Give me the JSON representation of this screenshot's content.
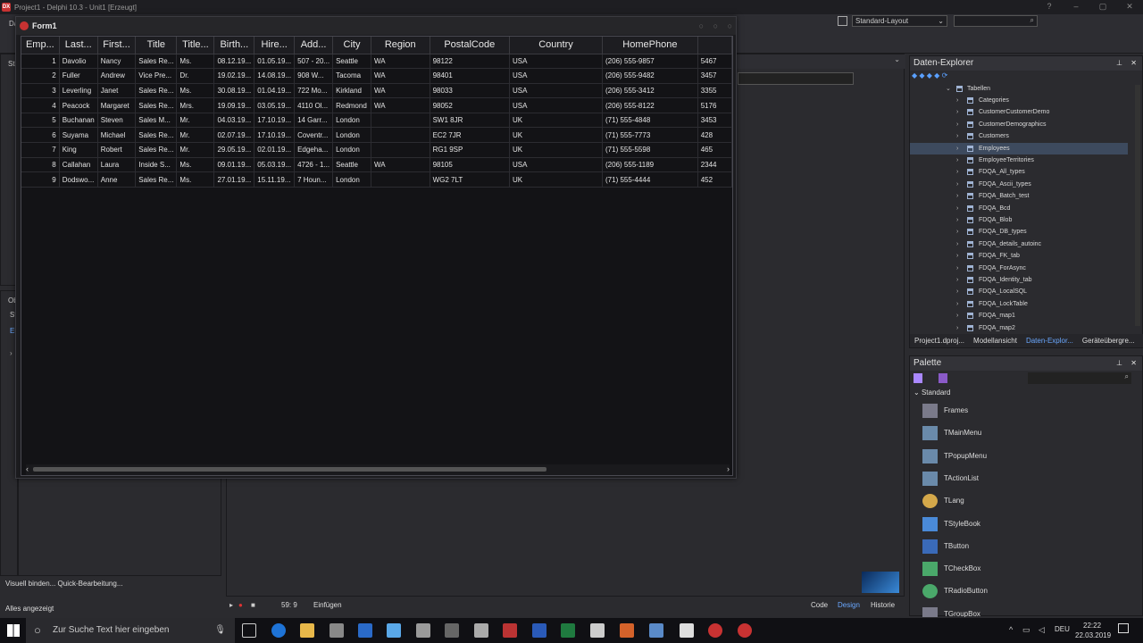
{
  "ide": {
    "title": "Project1 - Delphi 10.3 - Unit1 [Erzeugt]",
    "logo_text": "DX",
    "layout_select": "Standard-Layout",
    "toolbar_menu": "Da",
    "left_labels": [
      "Str",
      "Ob",
      "St",
      "Ei"
    ]
  },
  "form": {
    "title": "Form1",
    "columns": [
      "Emp...",
      "Last...",
      "First...",
      "Title",
      "Title...",
      "Birth...",
      "Hire...",
      "Add...",
      "City",
      "Region",
      "PostalCode",
      "Country",
      "HomePhone"
    ],
    "rows": [
      [
        "1",
        "Davolio",
        "Nancy",
        "Sales Re...",
        "Ms.",
        "08.12.19...",
        "01.05.19...",
        "507 - 20...",
        "Seattle",
        "WA",
        "98122",
        "USA",
        "(206) 555-9857",
        "5467"
      ],
      [
        "2",
        "Fuller",
        "Andrew",
        "Vice Pre...",
        "Dr.",
        "19.02.19...",
        "14.08.19...",
        "908 W...",
        "Tacoma",
        "WA",
        "98401",
        "USA",
        "(206) 555-9482",
        "3457"
      ],
      [
        "3",
        "Leverling",
        "Janet",
        "Sales Re...",
        "Ms.",
        "30.08.19...",
        "01.04.19...",
        "722 Mo...",
        "Kirkland",
        "WA",
        "98033",
        "USA",
        "(206) 555-3412",
        "3355"
      ],
      [
        "4",
        "Peacock",
        "Margaret",
        "Sales Re...",
        "Mrs.",
        "19.09.19...",
        "03.05.19...",
        "4110 Ol...",
        "Redmond",
        "WA",
        "98052",
        "USA",
        "(206) 555-8122",
        "5176"
      ],
      [
        "5",
        "Buchanan",
        "Steven",
        "Sales M...",
        "Mr.",
        "04.03.19...",
        "17.10.19...",
        "14 Garr...",
        "London",
        "",
        "SW1 8JR",
        "UK",
        "(71) 555-4848",
        "3453"
      ],
      [
        "6",
        "Suyama",
        "Michael",
        "Sales Re...",
        "Mr.",
        "02.07.19...",
        "17.10.19...",
        "Coventr...",
        "London",
        "",
        "EC2 7JR",
        "UK",
        "(71) 555-7773",
        "428"
      ],
      [
        "7",
        "King",
        "Robert",
        "Sales Re...",
        "Mr.",
        "29.05.19...",
        "02.01.19...",
        "Edgeha...",
        "London",
        "",
        "RG1 9SP",
        "UK",
        "(71) 555-5598",
        "465"
      ],
      [
        "8",
        "Callahan",
        "Laura",
        "Inside S...",
        "Ms.",
        "09.01.19...",
        "05.03.19...",
        "4726 - 1...",
        "Seattle",
        "WA",
        "98105",
        "USA",
        "(206) 555-1189",
        "2344"
      ],
      [
        "9",
        "Dodswo...",
        "Anne",
        "Sales Re...",
        "Ms.",
        "27.01.19...",
        "15.11.19...",
        "7 Houn...",
        "London",
        "",
        "WG2 7LT",
        "UK",
        "(71) 555-4444",
        "452"
      ]
    ]
  },
  "data_explorer": {
    "title": "Daten-Explorer",
    "tables_node": "Tabellen",
    "items": [
      "Categories",
      "CustomerCustomerDemo",
      "CustomerDemographics",
      "Customers",
      "Employees",
      "EmployeeTerritories",
      "FDQA_All_types",
      "FDQA_Ascii_types",
      "FDQA_Batch_test",
      "FDQA_Bcd",
      "FDQA_Blob",
      "FDQA_DB_types",
      "FDQA_details_autoinc",
      "FDQA_FK_tab",
      "FDQA_ForAsync",
      "FDQA_Identity_tab",
      "FDQA_LocalSQL",
      "FDQA_LockTable",
      "FDQA_map1",
      "FDQA_map2"
    ],
    "tabs": [
      "Project1.dproj...",
      "Modellansicht",
      "Daten-Explor...",
      "Geräteübergre..."
    ]
  },
  "palette": {
    "title": "Palette",
    "category": "Standard",
    "items": [
      "Frames",
      "TMainMenu",
      "TPopupMenu",
      "TActionList",
      "TLang",
      "TStyleBook",
      "TButton",
      "TCheckBox",
      "TRadioButton",
      "TGroupBox"
    ]
  },
  "status": {
    "left_line1": "Visuell binden... Quick-Bearbeitung...",
    "left_line2": "Alles angezeigt",
    "position": "59: 9",
    "mode": "Einfügen",
    "view_tabs": [
      "Code",
      "Design",
      "Historie"
    ]
  },
  "taskbar": {
    "search_placeholder": "Zur Suche Text hier eingeben",
    "lang": "DEU",
    "time": "22:22",
    "date": "22.03.2019"
  },
  "colors": {
    "accent": "#6aa8ff",
    "selection": "#3d4a5e",
    "brand_red": "#c83232"
  }
}
